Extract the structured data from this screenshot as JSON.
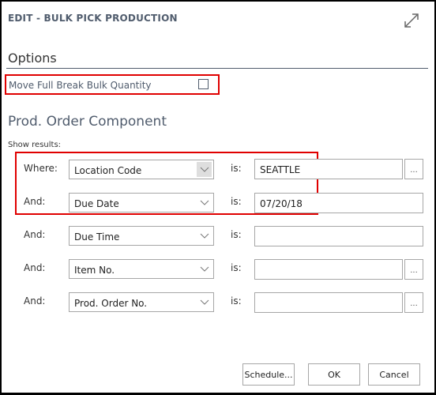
{
  "dialog": {
    "title": "EDIT - BULK PICK PRODUCTION",
    "expand_icon": "expand-diagonal-arrows-icon"
  },
  "options": {
    "heading": "Options",
    "move_full_break_bulk": {
      "label": "Move Full Break Bulk Quantity",
      "checked": false
    }
  },
  "component": {
    "heading": "Prod. Order Component",
    "show_results_label": "Show results:",
    "is_label": "is:",
    "lookup_label": "...",
    "filters": [
      {
        "connector": "Where:",
        "field": "Location Code",
        "value": "SEATTLE",
        "has_lookup": true
      },
      {
        "connector": "And:",
        "field": "Due Date",
        "value": "07/20/18",
        "has_lookup": false
      },
      {
        "connector": "And:",
        "field": "Due Time",
        "value": "",
        "has_lookup": false
      },
      {
        "connector": "And:",
        "field": "Item No.",
        "value": "",
        "has_lookup": true
      },
      {
        "connector": "And:",
        "field": "Prod. Order No.",
        "value": "",
        "has_lookup": true
      }
    ]
  },
  "buttons": {
    "schedule": "Schedule...",
    "ok": "OK",
    "cancel": "Cancel"
  },
  "highlight_color": "#e00000"
}
